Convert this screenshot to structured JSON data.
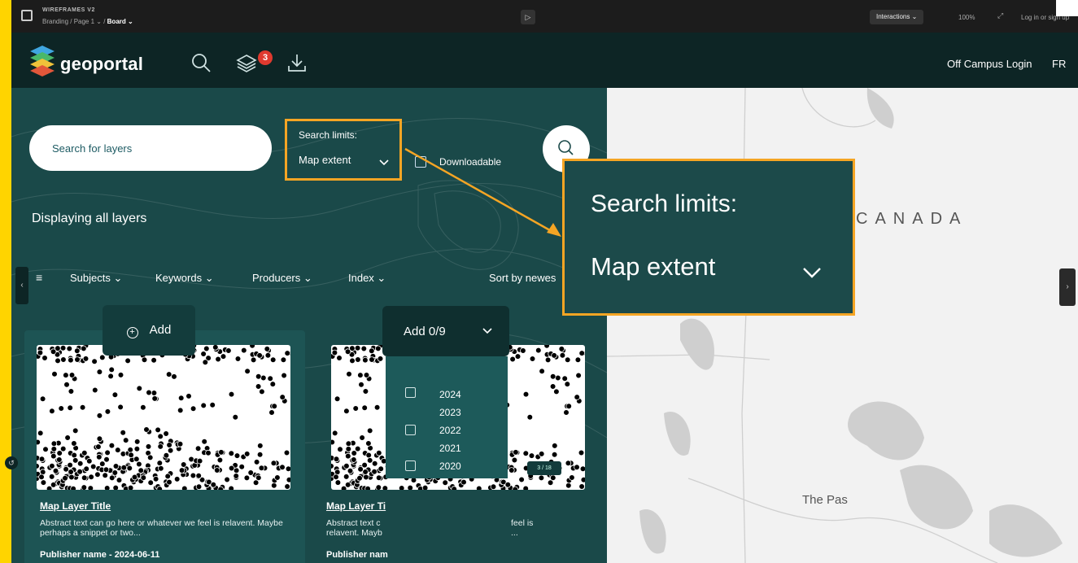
{
  "figma": {
    "project": "WIREFRAMES V2",
    "crumb_prefix": "Branding / Page 1  ⌄  /",
    "crumb_page": "Board ⌄",
    "interactions_label": "Interactions ⌄",
    "zoom": "100%",
    "login": "Log in or sign up"
  },
  "header": {
    "brand": "geoportal",
    "layers_badge": "3",
    "off_campus": "Off Campus Login",
    "lang": "FR"
  },
  "search": {
    "placeholder": "Search for layers",
    "limits_label": "Search limits:",
    "limits_value": "Map extent",
    "downloadable_label": "Downloadable"
  },
  "displaying": "Displaying all layers",
  "filters": {
    "subjects": "Subjects ⌄",
    "keywords": "Keywords ⌄",
    "producers": "Producers ⌄",
    "index": "Index ⌄",
    "sort": "Sort by newes"
  },
  "cards": [
    {
      "title": "Map Layer Title",
      "abstract": "Abstract text can go here or whatever we feel is relavent. Maybe perhaps a snippet or two...",
      "publisher": "Publisher name - 2024-06-11",
      "add_label": "Add"
    },
    {
      "title": "Map Layer Ti",
      "abstract_left": "Abstract text c",
      "abstract_left2": "relavent. Mayb",
      "abstract_right": "feel is",
      "abstract_right2": "...",
      "publisher": "Publisher nam",
      "add_label": "Add 0/9"
    }
  ],
  "years": [
    "2024",
    "2023",
    "2022",
    "2021",
    "2020"
  ],
  "page_count": "3 / 18",
  "map": {
    "country": "CANADA",
    "town": "The Pas"
  },
  "callout": {
    "label": "Search limits:",
    "value": "Map extent"
  },
  "colors": {
    "frame": "#ffd400",
    "panel": "#1a4949",
    "header": "#0d2525",
    "highlight": "#f5a524",
    "badge": "#e03a2f"
  }
}
